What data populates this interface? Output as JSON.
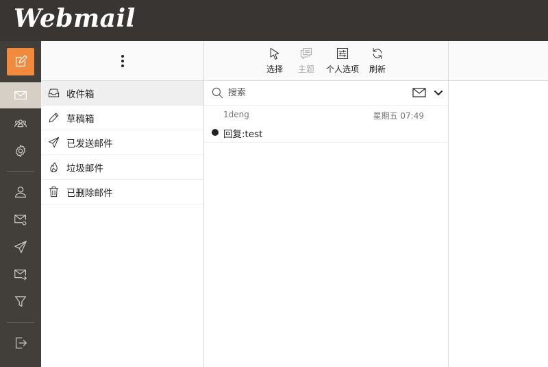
{
  "app": {
    "logo": "Webmail"
  },
  "colors": {
    "topbar": "#383532",
    "sidebar": "#423f3b",
    "accent": "#f18a3c",
    "active_nav": "#d6cfc6"
  },
  "sidebar": {
    "icons": [
      "compose-icon",
      "mail-icon",
      "contacts-icon",
      "settings-icon",
      "user-icon",
      "mail-settings-icon",
      "send-icon",
      "mail-forward-icon",
      "filter-icon",
      "logout-icon"
    ]
  },
  "folders": [
    {
      "label": "收件箱",
      "icon": "inbox-icon",
      "active": true
    },
    {
      "label": "草稿箱",
      "icon": "pencil-icon",
      "active": false
    },
    {
      "label": "已发送邮件",
      "icon": "paper-plane-icon",
      "active": false
    },
    {
      "label": "垃圾邮件",
      "icon": "fire-icon",
      "active": false
    },
    {
      "label": "已删除邮件",
      "icon": "trash-icon",
      "active": false
    }
  ],
  "toolbar": {
    "select": "选择",
    "thread": "主题",
    "options": "个人选项",
    "refresh": "刷新"
  },
  "search": {
    "placeholder": "搜索"
  },
  "messages": [
    {
      "from": "1deng",
      "date": "星期五 07:49",
      "subject": "回复:test",
      "unread": true
    }
  ]
}
